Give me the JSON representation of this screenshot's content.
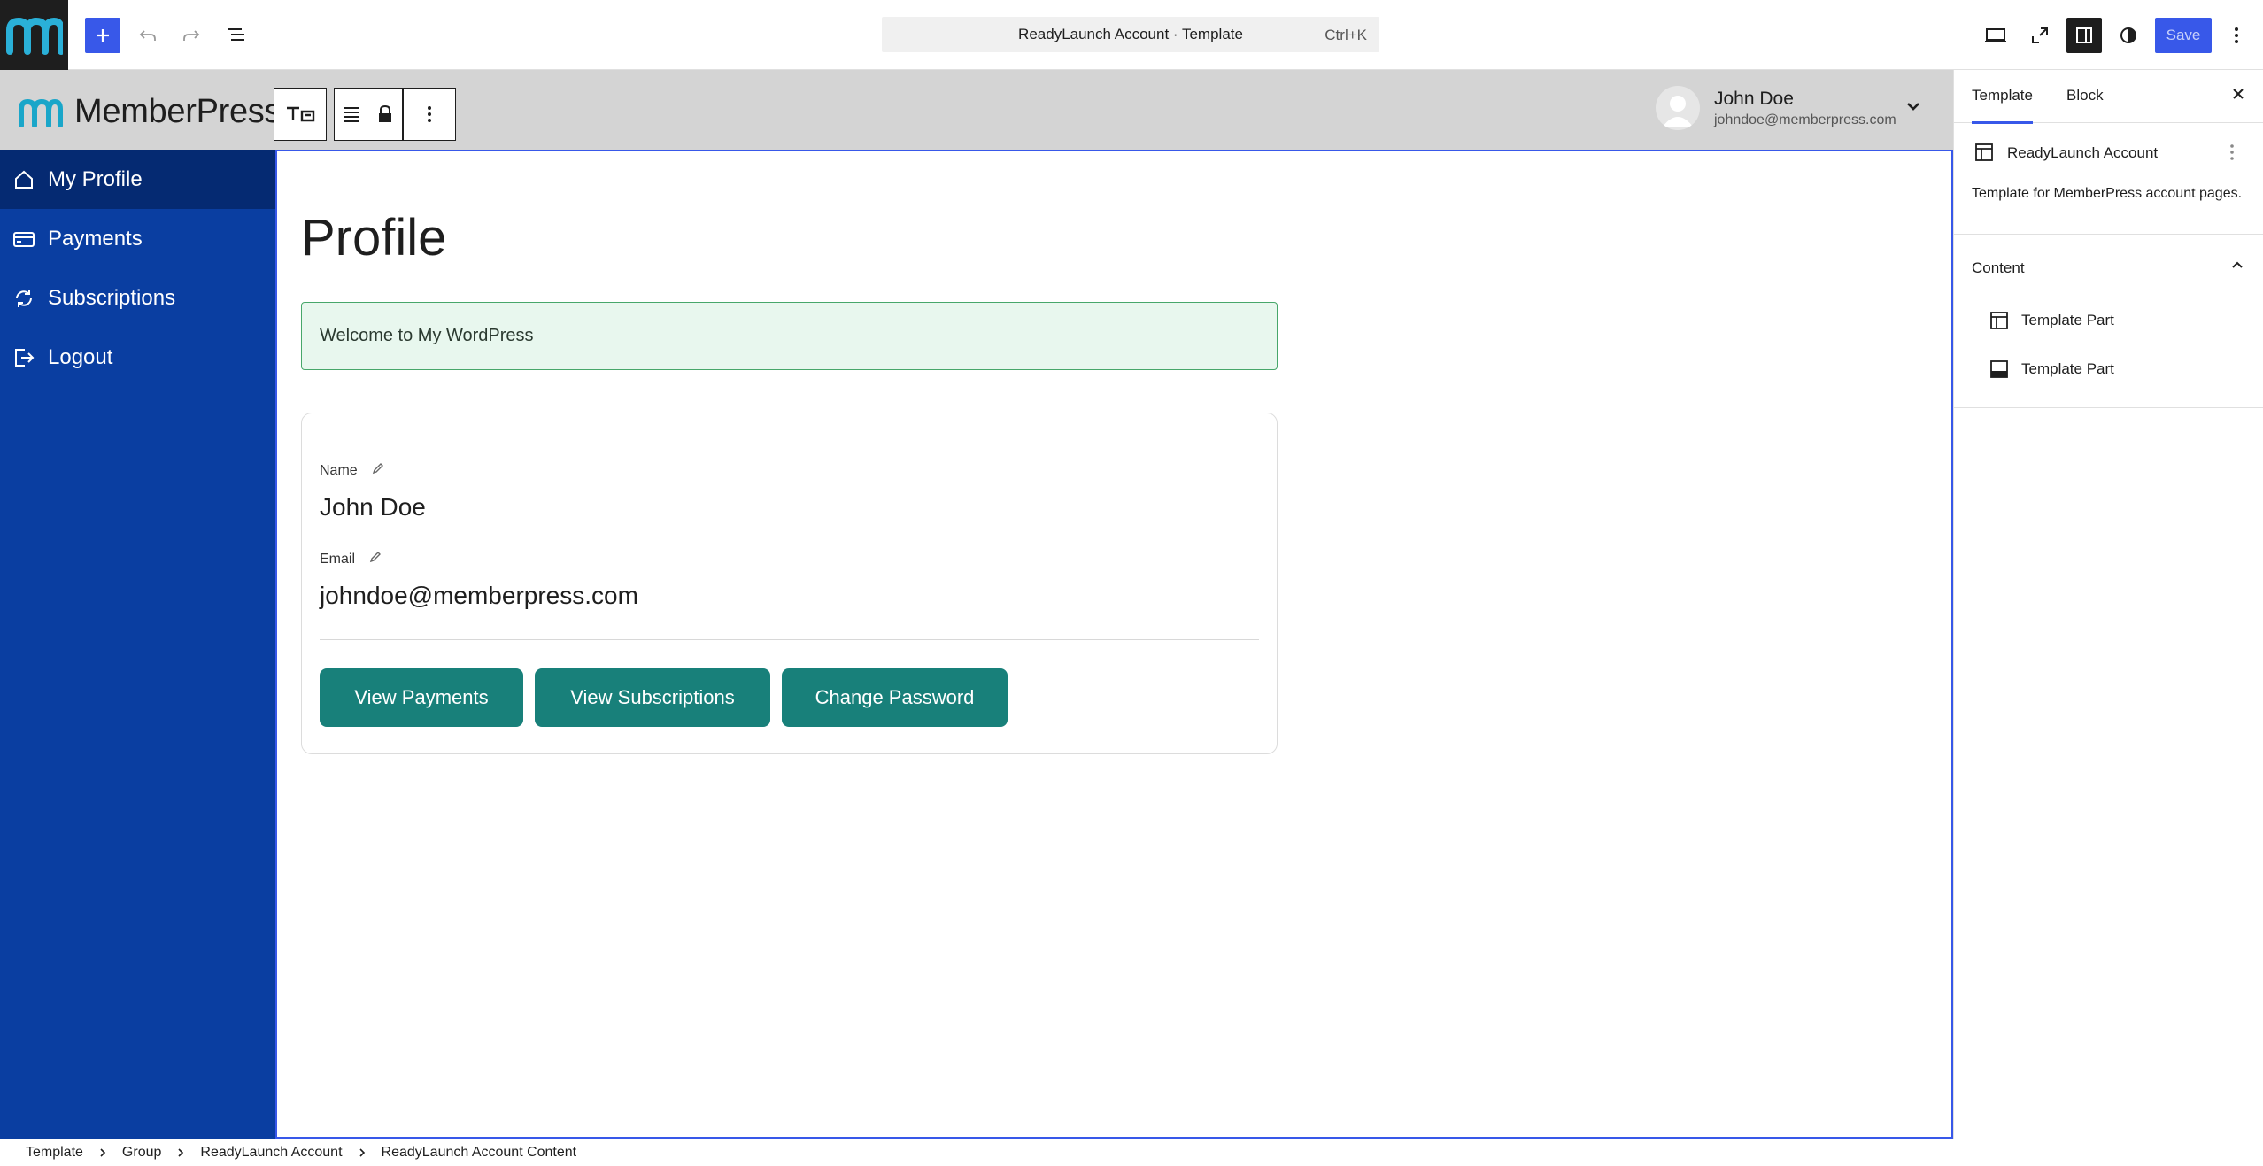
{
  "editor": {
    "document_title": "ReadyLaunch Account · Template",
    "shortcut": "Ctrl+K",
    "save_label": "Save"
  },
  "site_header": {
    "logo_text": "MemberPress",
    "user_name": "John Doe",
    "user_email": "johndoe@memberpress.com"
  },
  "nav": {
    "items": [
      {
        "label": "My Profile"
      },
      {
        "label": "Payments"
      },
      {
        "label": "Subscriptions"
      },
      {
        "label": "Logout"
      }
    ]
  },
  "profile": {
    "title": "Profile",
    "notice": "Welcome to My WordPress",
    "name_label": "Name",
    "name_value": "John Doe",
    "email_label": "Email",
    "email_value": "johndoe@memberpress.com",
    "buttons": {
      "payments": "View Payments",
      "subscriptions": "View Subscriptions",
      "password": "Change Password"
    }
  },
  "settings": {
    "tabs": {
      "template": "Template",
      "block": "Block"
    },
    "template_name": "ReadyLaunch Account",
    "template_desc": "Template for MemberPress account pages.",
    "content_title": "Content",
    "parts": [
      {
        "label": "Template Part"
      },
      {
        "label": "Template Part"
      }
    ]
  },
  "breadcrumbs": [
    "Template",
    "Group",
    "ReadyLaunch Account",
    "ReadyLaunch Account Content"
  ],
  "colors": {
    "accent": "#3858e9",
    "nav_bg": "#0a3ea1",
    "nav_active": "#052a72",
    "button_teal": "#18807a",
    "notice_bg": "#e8f7ee"
  }
}
